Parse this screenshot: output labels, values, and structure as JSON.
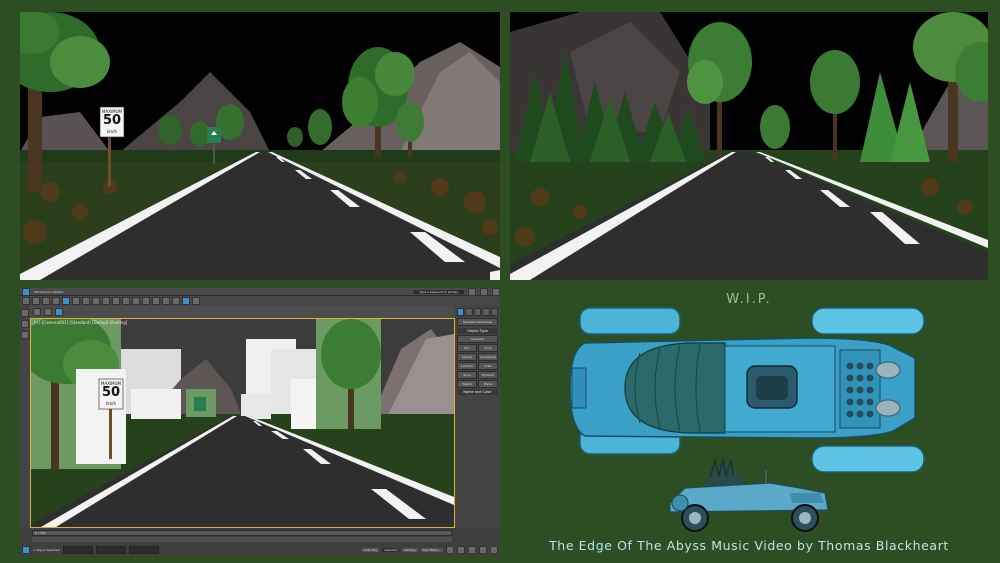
{
  "overlay": {
    "wip_label": "W.I.P.",
    "credit_line": "The Edge Of The Abyss Music Video by Thomas Blackheart"
  },
  "signs": {
    "maximum_label": "MAXIMUM",
    "speed_value": "50",
    "speed_unit": "km/h"
  },
  "max_ui": {
    "workspace_label": "Workspace: Default",
    "search_placeholder": "Type a keyword or phrase",
    "viewport_label": "[+] [Camera001] [Standard] [Default Shading]",
    "command_panel": {
      "header": "Object Type",
      "autogrid": "AutoGrid",
      "buttons": [
        "Box",
        "Cone",
        "Sphere",
        "GeoSphere",
        "Cylinder",
        "Tube",
        "Torus",
        "Pyramid",
        "Teapot",
        "Plane"
      ],
      "name_header": "Name and Color",
      "dropdown": "Standard Primitives"
    },
    "status": {
      "selected": "1 Object Selected",
      "frame": "0 / 100",
      "auto_key": "Auto Key",
      "selected_btn": "Selected",
      "set_key": "Set Key",
      "key_filters": "Key Filters..."
    }
  },
  "colors": {
    "background": "#2d4d23",
    "car_blue": "#4bb4d8",
    "road": "#2e2e2e",
    "credit_text": "#b9e4f0"
  }
}
